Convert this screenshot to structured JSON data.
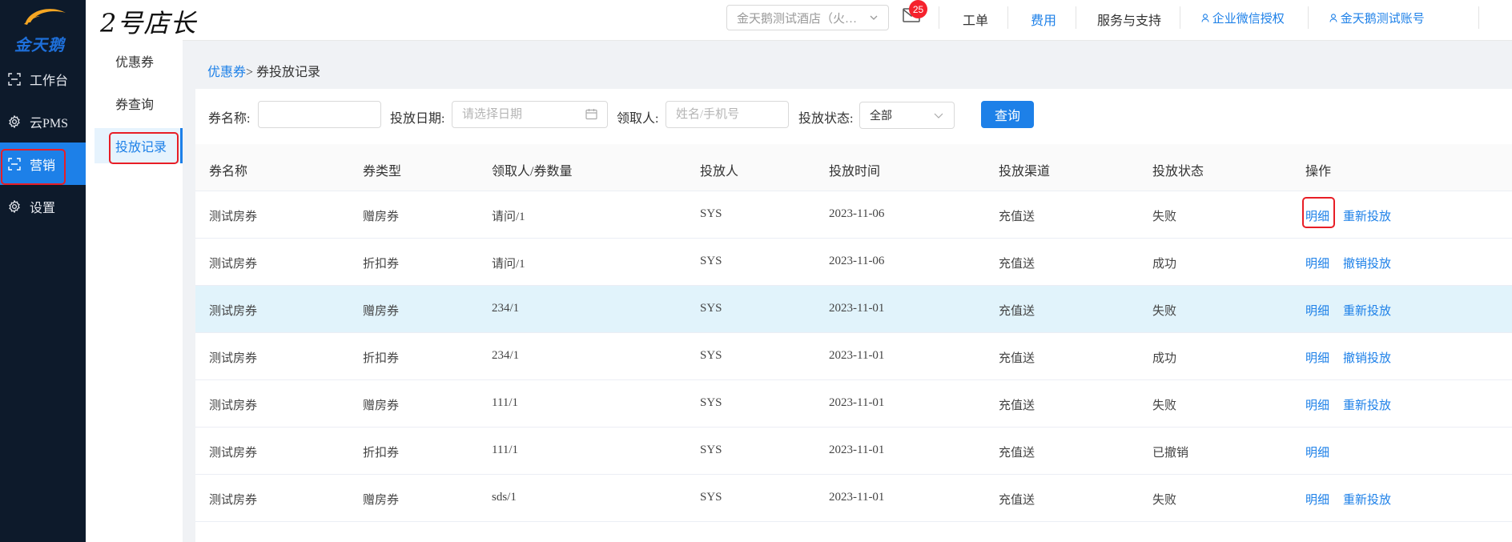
{
  "sidebar": {
    "logo_text": "金天鹅",
    "items": [
      {
        "label": "工作台",
        "icon": "scan-icon"
      },
      {
        "label": "云PMS",
        "icon": "gear-icon"
      },
      {
        "label": "营销",
        "icon": "scan-icon",
        "active": true
      },
      {
        "label": "设置",
        "icon": "gear-icon"
      }
    ]
  },
  "header": {
    "brand": "2号店长",
    "hotel_select": "金天鹅测试酒店（火…",
    "mail_badge": "25",
    "links": {
      "work_order": "工单",
      "fees": "费用",
      "service": "服务与支持",
      "wechat_auth": "企业微信授权",
      "account": "金天鹅测试账号"
    }
  },
  "submenu": {
    "items": [
      {
        "label": "优惠券"
      },
      {
        "label": "券查询"
      },
      {
        "label": "投放记录",
        "active": true
      }
    ]
  },
  "breadcrumb": {
    "parent": "优惠券",
    "sep": ">",
    "current": "券投放记录"
  },
  "filters": {
    "coupon_name_label": "券名称:",
    "coupon_name_value": "",
    "date_label": "投放日期:",
    "date_placeholder": "请选择日期",
    "receiver_label": "领取人:",
    "receiver_placeholder": "姓名/手机号",
    "status_label": "投放状态:",
    "status_value": "全部",
    "query_button": "查询"
  },
  "table": {
    "headers": [
      "券名称",
      "券类型",
      "领取人/券数量",
      "投放人",
      "投放时间",
      "投放渠道",
      "投放状态",
      "操作"
    ],
    "rows": [
      {
        "name": "测试房券",
        "type": "赠房券",
        "receiver": "请问/1",
        "operator": "SYS",
        "time": "2023-11-06",
        "channel": "充值送",
        "status": "失败",
        "actions": [
          "明细",
          "重新投放"
        ]
      },
      {
        "name": "测试房券",
        "type": "折扣券",
        "receiver": "请问/1",
        "operator": "SYS",
        "time": "2023-11-06",
        "channel": "充值送",
        "status": "成功",
        "actions": [
          "明细",
          "撤销投放"
        ]
      },
      {
        "name": "测试房券",
        "type": "赠房券",
        "receiver": "234/1",
        "operator": "SYS",
        "time": "2023-11-01",
        "channel": "充值送",
        "status": "失败",
        "actions": [
          "明细",
          "重新投放"
        ]
      },
      {
        "name": "测试房券",
        "type": "折扣券",
        "receiver": "234/1",
        "operator": "SYS",
        "time": "2023-11-01",
        "channel": "充值送",
        "status": "成功",
        "actions": [
          "明细",
          "撤销投放"
        ]
      },
      {
        "name": "测试房券",
        "type": "赠房券",
        "receiver": "111/1",
        "operator": "SYS",
        "time": "2023-11-01",
        "channel": "充值送",
        "status": "失败",
        "actions": [
          "明细",
          "重新投放"
        ]
      },
      {
        "name": "测试房券",
        "type": "折扣券",
        "receiver": "111/1",
        "operator": "SYS",
        "time": "2023-11-01",
        "channel": "充值送",
        "status": "已撤销",
        "actions": [
          "明细"
        ]
      },
      {
        "name": "测试房券",
        "type": "赠房券",
        "receiver": "sds/1",
        "operator": "SYS",
        "time": "2023-11-01",
        "channel": "充值送",
        "status": "失败",
        "actions": [
          "明细",
          "重新投放"
        ]
      }
    ]
  },
  "colors": {
    "accent": "#1d80e8",
    "sidebar_bg": "#0d1a2b",
    "highlight_box": "#e81e26",
    "row_hover": "#e1f3fb",
    "badge": "#f5222d"
  }
}
